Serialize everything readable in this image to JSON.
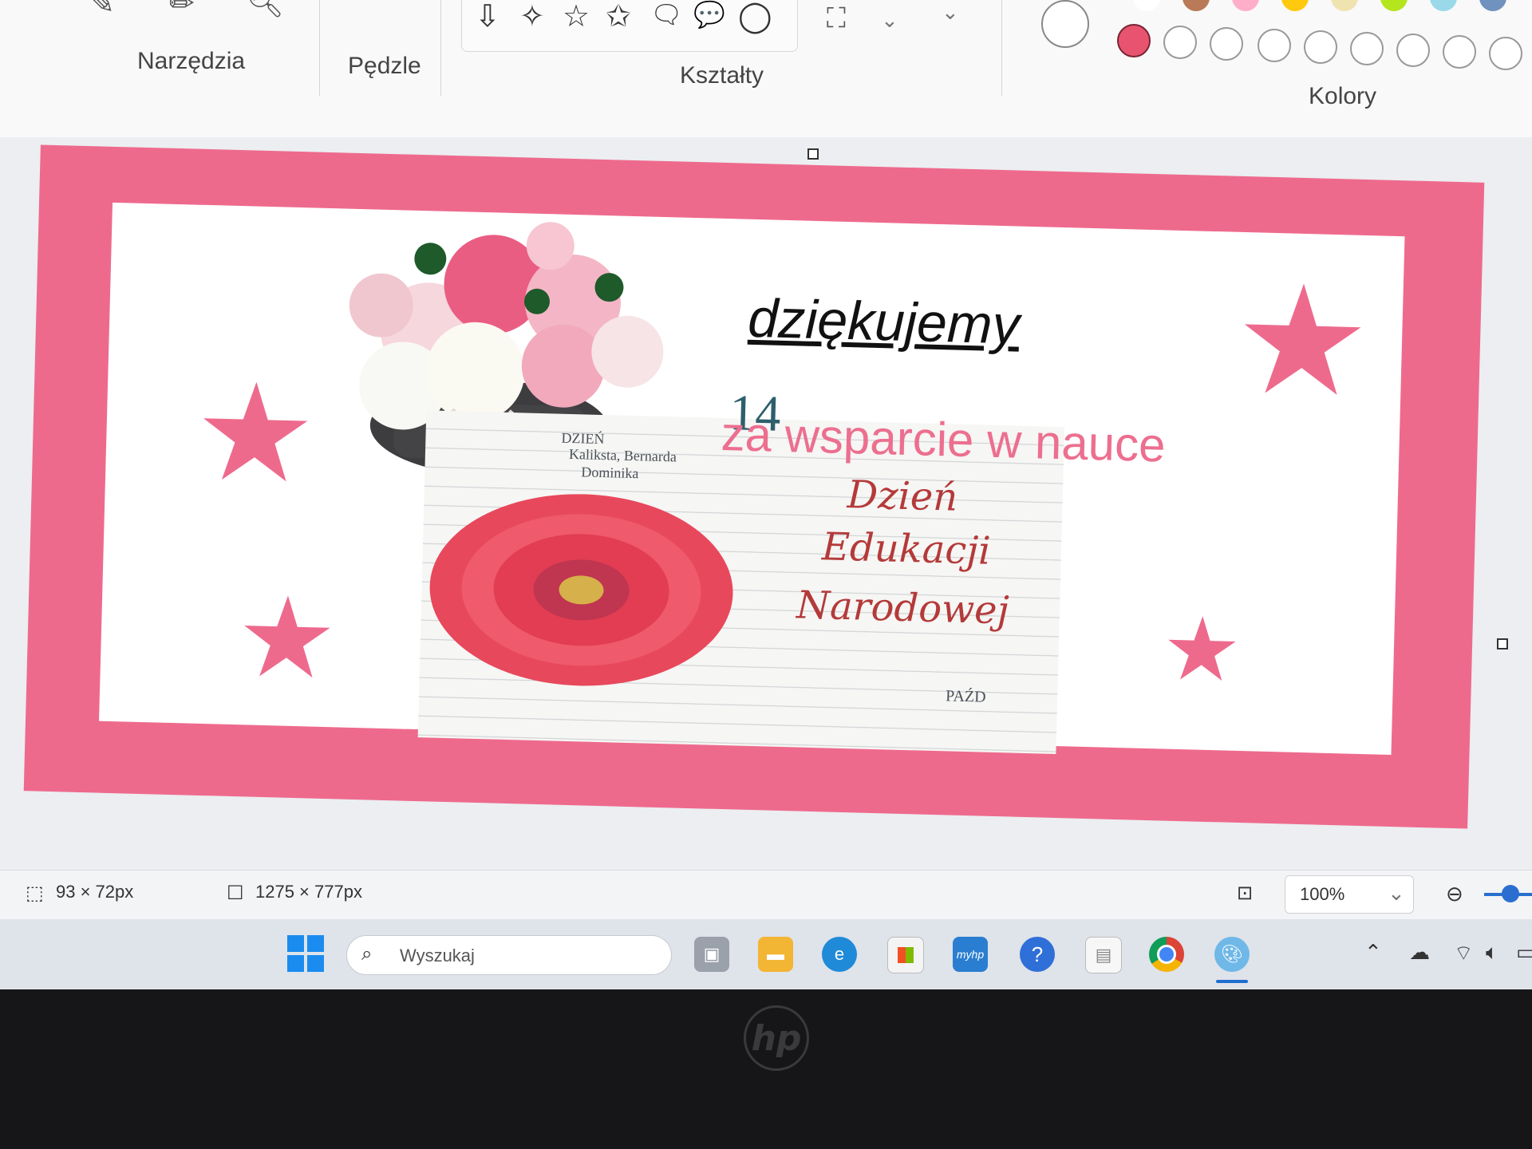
{
  "ribbon": {
    "groups": {
      "tools_label": "Narzędzia",
      "brushes_label": "Pędzle",
      "shapes_label": "Kształty",
      "colors_label": "Kolory"
    },
    "shape_glyphs": [
      "⇩",
      "✧",
      "☆",
      "✩",
      "🗨",
      "💬",
      "◯"
    ],
    "selected_color": "#e8546f",
    "palette_top_colors": [
      "#ffffff",
      "#b97a57",
      "#ffaec9",
      "#ffc90e",
      "#efe4b0",
      "#b5e61d",
      "#99d9ea",
      "#7092be"
    ]
  },
  "canvas": {
    "thanks_text": "dziękujemy",
    "support_text": "za wsparcie w nauce",
    "calendar": {
      "day": "14",
      "header": "DZIEŃ",
      "names": "Kaliksta, Bernarda",
      "names2": "Dominika",
      "month": "PAŹD"
    },
    "greeting_lines": [
      "Dzień",
      "Edukacji",
      "Narodowej"
    ],
    "border_color": "#ee6a8d"
  },
  "status_bar": {
    "selection_size": "93 × 72px",
    "image_size": "1275 × 777px",
    "zoom": "100%"
  },
  "taskbar": {
    "search_placeholder": "Wyszukaj",
    "myhp_label": "myhp"
  },
  "bezel": {
    "logo": "hp"
  }
}
